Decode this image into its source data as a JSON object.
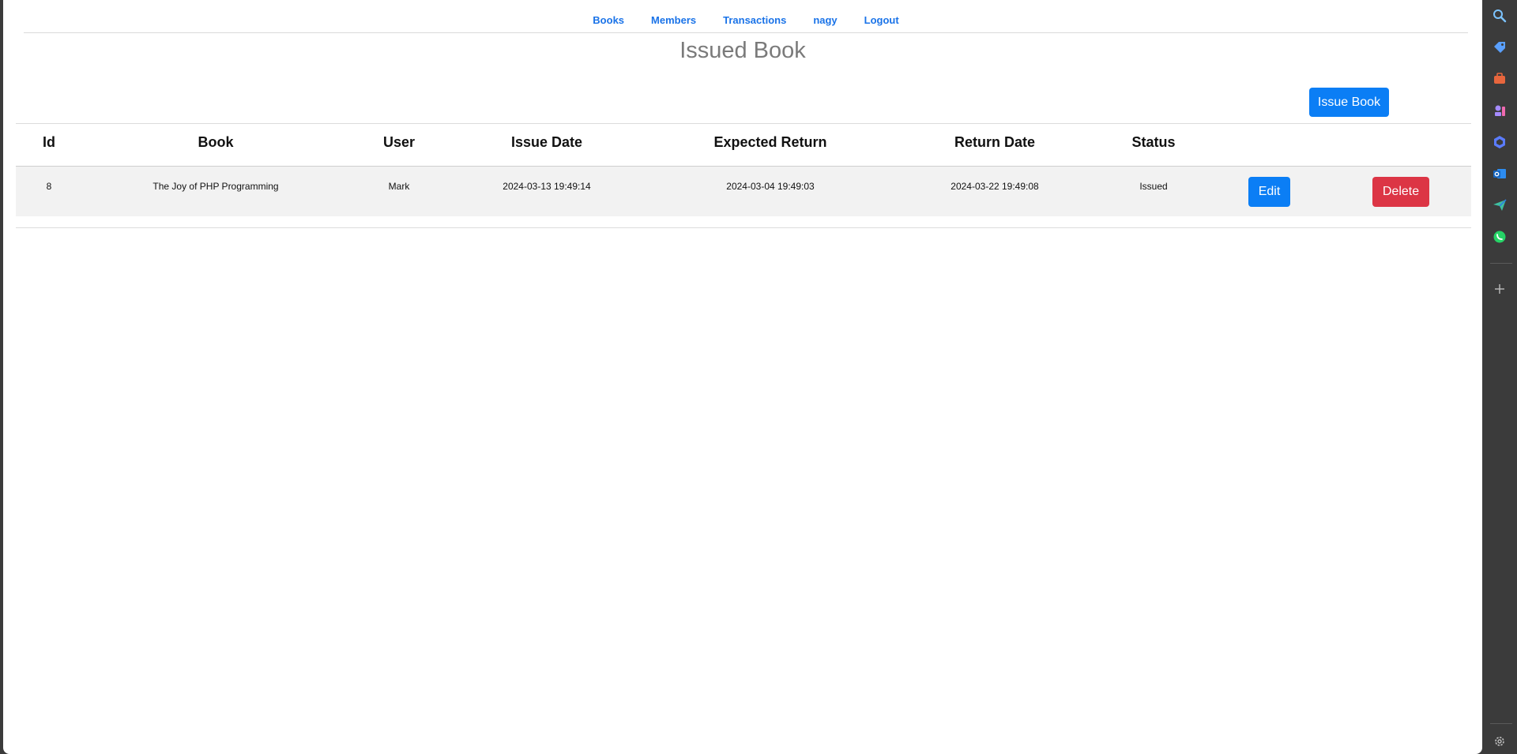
{
  "nav": {
    "items": [
      "Books",
      "Members",
      "Transactions",
      "nagy",
      "Logout"
    ]
  },
  "page": {
    "title": "Issued Book",
    "issue_button": "Issue Book"
  },
  "table": {
    "headers": [
      "Id",
      "Book",
      "User",
      "Issue Date",
      "Expected Return",
      "Return Date",
      "Status"
    ],
    "rows": [
      {
        "id": "8",
        "book": "The Joy of PHP Programming",
        "user": "Mark",
        "issue_date": "2024-03-13 19:49:14",
        "expected_return": "2024-03-04 19:49:03",
        "return_date": "2024-03-22 19:49:08",
        "status": "Issued",
        "edit_label": "Edit",
        "delete_label": "Delete"
      }
    ]
  },
  "sidebar": {
    "icons": [
      "search-icon",
      "tag-icon",
      "briefcase-icon",
      "chess-icon",
      "copilot-icon",
      "outlook-icon",
      "send-icon",
      "whatsapp-icon",
      "plus-icon",
      "gear-icon"
    ]
  },
  "colors": {
    "primary": "#0b7ef5",
    "danger": "#dc3545",
    "nav_link": "#1a73e8",
    "title": "#7a7a7a",
    "row_bg": "#f2f2f2"
  }
}
